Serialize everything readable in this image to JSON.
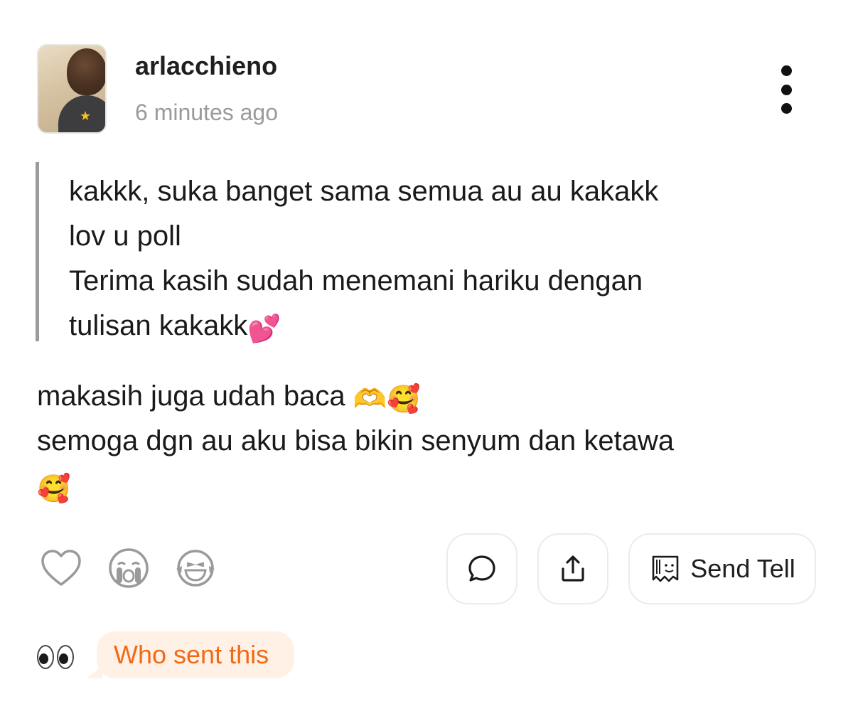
{
  "post": {
    "username": "arlacchieno",
    "timestamp": "6 minutes ago",
    "avatar_badge_icon": "star-icon"
  },
  "quote": {
    "lines": [
      "kakkk, suka banget sama semua au au kakakk",
      "lov u poll",
      "Terima kasih sudah menemani hariku dengan",
      "tulisan kakakk"
    ],
    "trailing_emoji": "💕"
  },
  "reply": {
    "line1": "makasih juga udah baca ",
    "line1_emoji": "🫶🥰",
    "line2": "semoga dgn au aku bisa bikin senyum dan ketawa",
    "line3_emoji": "🥰"
  },
  "reactions": [
    {
      "name": "heart-icon"
    },
    {
      "name": "crying-face-icon"
    },
    {
      "name": "laughing-face-icon"
    }
  ],
  "actions": {
    "comment_icon": "speech-bubble-icon",
    "share_icon": "share-icon",
    "send_tell_label": "Send Tell",
    "send_tell_icon": "paper-note-icon"
  },
  "who_sent": {
    "label": "Who sent this",
    "icon": "eyes-icon"
  },
  "colors": {
    "accent_orange": "#f06a14",
    "bubble_bg": "#fff1e6",
    "muted_gray": "#9a9a9a",
    "quote_bar": "#9b9b9b"
  }
}
